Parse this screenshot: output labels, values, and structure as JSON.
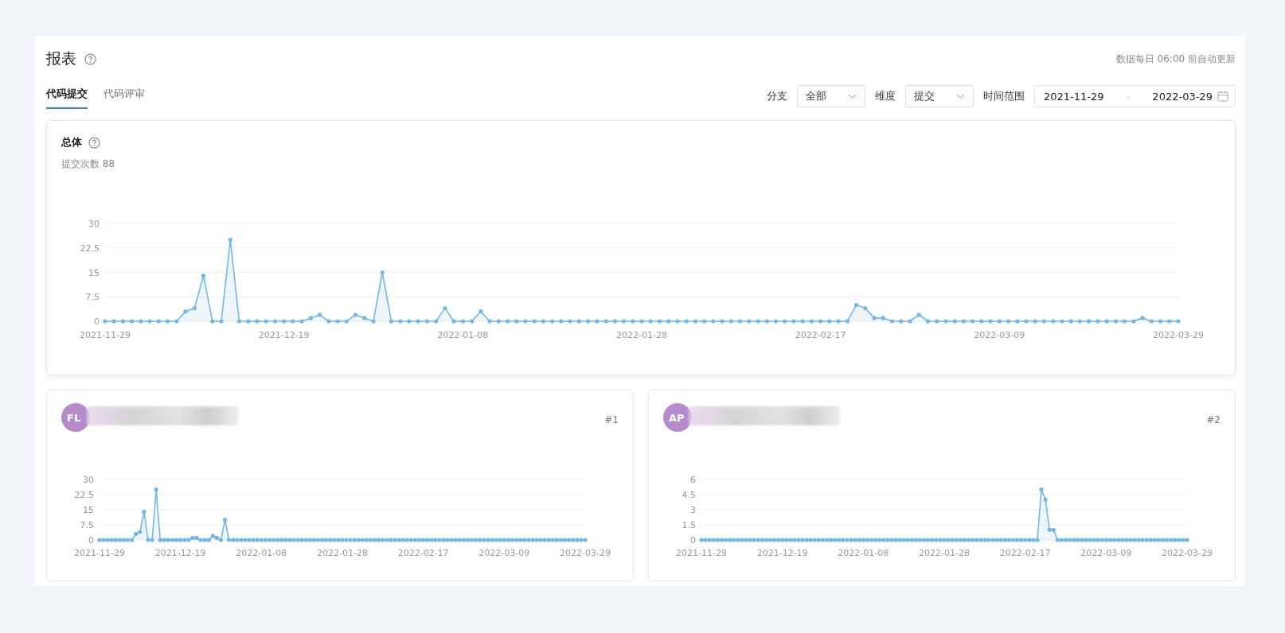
{
  "page": {
    "title": "报表",
    "update_note": "数据每日 06:00 前自动更新"
  },
  "tabs": [
    {
      "label": "代码提交",
      "selected": true
    },
    {
      "label": "代码评审",
      "selected": false
    }
  ],
  "filters": [
    {
      "kind": "select",
      "label": "分支",
      "value": "全部"
    },
    {
      "kind": "select",
      "label": "维度",
      "value": "提交"
    },
    {
      "kind": "daterange",
      "label": "时间范围",
      "start": "2021-11-29",
      "separator": "-",
      "end": "2022-03-29"
    }
  ],
  "overview": {
    "title": "总体",
    "summary": "提交次数 88",
    "chart_data": {
      "type": "area",
      "grid": true,
      "ylim": [
        0,
        30
      ],
      "yticks": [
        0,
        7.5,
        15,
        22.5,
        30
      ],
      "categories": [
        "2021-11-29",
        null,
        null,
        null,
        null,
        null,
        null,
        null,
        null,
        null,
        null,
        null,
        null,
        null,
        null,
        null,
        null,
        null,
        null,
        null,
        "2021-12-19",
        null,
        null,
        null,
        null,
        null,
        null,
        null,
        null,
        null,
        null,
        null,
        null,
        null,
        null,
        null,
        null,
        null,
        null,
        null,
        "2022-01-08",
        null,
        null,
        null,
        null,
        null,
        null,
        null,
        null,
        null,
        null,
        null,
        null,
        null,
        null,
        null,
        null,
        null,
        null,
        null,
        "2022-01-28",
        null,
        null,
        null,
        null,
        null,
        null,
        null,
        null,
        null,
        null,
        null,
        null,
        null,
        null,
        null,
        null,
        null,
        null,
        null,
        "2022-02-17",
        null,
        null,
        null,
        null,
        null,
        null,
        null,
        null,
        null,
        null,
        null,
        null,
        null,
        null,
        null,
        null,
        null,
        null,
        null,
        "2022-03-09",
        null,
        null,
        null,
        null,
        null,
        null,
        null,
        null,
        null,
        null,
        null,
        null,
        null,
        null,
        null,
        null,
        null,
        null,
        null,
        "2022-03-29"
      ],
      "series": [
        {
          "color": "#74b6e6",
          "values": [
            0,
            0,
            0,
            0,
            0,
            0,
            0,
            0,
            0,
            3,
            4,
            14,
            0,
            0,
            25,
            0,
            0,
            0,
            0,
            0,
            0,
            0,
            0,
            1,
            2,
            0,
            0,
            0,
            2,
            1,
            0,
            15,
            0,
            0,
            0,
            0,
            0,
            0,
            4,
            0,
            0,
            0,
            3,
            0,
            0,
            0,
            0,
            0,
            0,
            0,
            0,
            0,
            0,
            0,
            0,
            0,
            0,
            0,
            0,
            0,
            0,
            0,
            0,
            0,
            0,
            0,
            0,
            0,
            0,
            0,
            0,
            0,
            0,
            0,
            0,
            0,
            0,
            0,
            0,
            0,
            0,
            0,
            0,
            0,
            5,
            4,
            1,
            1,
            0,
            0,
            0,
            2,
            0,
            0,
            0,
            0,
            0,
            0,
            0,
            0,
            0,
            0,
            0,
            0,
            0,
            0,
            0,
            0,
            0,
            0,
            0,
            0,
            0,
            0,
            0,
            0,
            1,
            0,
            0,
            0,
            0
          ]
        }
      ]
    }
  },
  "members": [
    {
      "initials": "FL",
      "rank": "#1",
      "chart_data": {
        "type": "area",
        "grid": true,
        "ylim": [
          0,
          30
        ],
        "yticks": [
          0,
          7.5,
          15,
          22.5,
          30
        ],
        "categories": [
          "2021-11-29",
          null,
          null,
          null,
          null,
          null,
          null,
          null,
          null,
          null,
          null,
          null,
          null,
          null,
          null,
          null,
          null,
          null,
          null,
          null,
          "2021-12-19",
          null,
          null,
          null,
          null,
          null,
          null,
          null,
          null,
          null,
          null,
          null,
          null,
          null,
          null,
          null,
          null,
          null,
          null,
          null,
          "2022-01-08",
          null,
          null,
          null,
          null,
          null,
          null,
          null,
          null,
          null,
          null,
          null,
          null,
          null,
          null,
          null,
          null,
          null,
          null,
          null,
          "2022-01-28",
          null,
          null,
          null,
          null,
          null,
          null,
          null,
          null,
          null,
          null,
          null,
          null,
          null,
          null,
          null,
          null,
          null,
          null,
          null,
          "2022-02-17",
          null,
          null,
          null,
          null,
          null,
          null,
          null,
          null,
          null,
          null,
          null,
          null,
          null,
          null,
          null,
          null,
          null,
          null,
          null,
          "2022-03-09",
          null,
          null,
          null,
          null,
          null,
          null,
          null,
          null,
          null,
          null,
          null,
          null,
          null,
          null,
          null,
          null,
          null,
          null,
          null,
          "2022-03-29"
        ],
        "series": [
          {
            "color": "#74b6e6",
            "values": [
              0,
              0,
              0,
              0,
              0,
              0,
              0,
              0,
              0,
              3,
              4,
              14,
              0,
              0,
              25,
              0,
              0,
              0,
              0,
              0,
              0,
              0,
              0,
              1,
              1,
              0,
              0,
              0,
              2,
              1,
              0,
              10,
              0,
              0,
              0,
              0,
              0,
              0,
              0,
              0,
              0,
              0,
              0,
              0,
              0,
              0,
              0,
              0,
              0,
              0,
              0,
              0,
              0,
              0,
              0,
              0,
              0,
              0,
              0,
              0,
              0,
              0,
              0,
              0,
              0,
              0,
              0,
              0,
              0,
              0,
              0,
              0,
              0,
              0,
              0,
              0,
              0,
              0,
              0,
              0,
              0,
              0,
              0,
              0,
              0,
              0,
              0,
              0,
              0,
              0,
              0,
              0,
              0,
              0,
              0,
              0,
              0,
              0,
              0,
              0,
              0,
              0,
              0,
              0,
              0,
              0,
              0,
              0,
              0,
              0,
              0,
              0,
              0,
              0,
              0,
              0,
              0,
              0,
              0,
              0,
              0
            ]
          }
        ]
      }
    },
    {
      "initials": "AP",
      "rank": "#2",
      "chart_data": {
        "type": "area",
        "grid": true,
        "ylim": [
          0,
          6
        ],
        "yticks": [
          0,
          1.5,
          3,
          4.5,
          6
        ],
        "categories": [
          "2021-11-29",
          null,
          null,
          null,
          null,
          null,
          null,
          null,
          null,
          null,
          null,
          null,
          null,
          null,
          null,
          null,
          null,
          null,
          null,
          null,
          "2021-12-19",
          null,
          null,
          null,
          null,
          null,
          null,
          null,
          null,
          null,
          null,
          null,
          null,
          null,
          null,
          null,
          null,
          null,
          null,
          null,
          "2022-01-08",
          null,
          null,
          null,
          null,
          null,
          null,
          null,
          null,
          null,
          null,
          null,
          null,
          null,
          null,
          null,
          null,
          null,
          null,
          null,
          "2022-01-28",
          null,
          null,
          null,
          null,
          null,
          null,
          null,
          null,
          null,
          null,
          null,
          null,
          null,
          null,
          null,
          null,
          null,
          null,
          null,
          "2022-02-17",
          null,
          null,
          null,
          null,
          null,
          null,
          null,
          null,
          null,
          null,
          null,
          null,
          null,
          null,
          null,
          null,
          null,
          null,
          null,
          "2022-03-09",
          null,
          null,
          null,
          null,
          null,
          null,
          null,
          null,
          null,
          null,
          null,
          null,
          null,
          null,
          null,
          null,
          null,
          null,
          null,
          "2022-03-29"
        ],
        "series": [
          {
            "color": "#74b6e6",
            "values": [
              0,
              0,
              0,
              0,
              0,
              0,
              0,
              0,
              0,
              0,
              0,
              0,
              0,
              0,
              0,
              0,
              0,
              0,
              0,
              0,
              0,
              0,
              0,
              0,
              0,
              0,
              0,
              0,
              0,
              0,
              0,
              0,
              0,
              0,
              0,
              0,
              0,
              0,
              0,
              0,
              0,
              0,
              0,
              0,
              0,
              0,
              0,
              0,
              0,
              0,
              0,
              0,
              0,
              0,
              0,
              0,
              0,
              0,
              0,
              0,
              0,
              0,
              0,
              0,
              0,
              0,
              0,
              0,
              0,
              0,
              0,
              0,
              0,
              0,
              0,
              0,
              0,
              0,
              0,
              0,
              0,
              0,
              0,
              0,
              5,
              4,
              1,
              1,
              0,
              0,
              0,
              0,
              0,
              0,
              0,
              0,
              0,
              0,
              0,
              0,
              0,
              0,
              0,
              0,
              0,
              0,
              0,
              0,
              0,
              0,
              0,
              0,
              0,
              0,
              0,
              0,
              0,
              0,
              0,
              0,
              0
            ]
          }
        ]
      }
    }
  ]
}
